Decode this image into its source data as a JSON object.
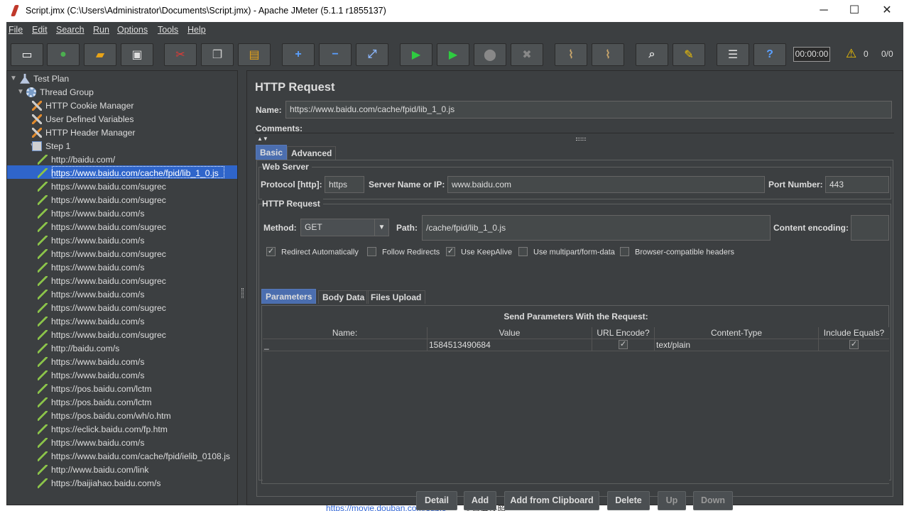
{
  "window": {
    "title": "Script.jmx (C:\\Users\\Administrator\\Documents\\Script.jmx) - Apache JMeter (5.1.1 r1855137)",
    "minimize": "─",
    "maximize": "☐",
    "close": "✕"
  },
  "menu": [
    "File",
    "Edit",
    "Search",
    "Run",
    "Options",
    "Tools",
    "Help"
  ],
  "toolbar": {
    "timer": "00:00:00",
    "warnings": "0",
    "threads": "0/0"
  },
  "tree": {
    "items": [
      {
        "label": "Test Plan",
        "icon": "flask-icon",
        "level": 0,
        "expand": "▼"
      },
      {
        "label": "Thread Group",
        "icon": "gear-icon",
        "level": 1,
        "expand": "▼"
      },
      {
        "label": "HTTP Cookie Manager",
        "icon": "wrench-icon",
        "level": 2,
        "expand": ""
      },
      {
        "label": "User Defined Variables",
        "icon": "wrench-icon",
        "level": 2,
        "expand": ""
      },
      {
        "label": "HTTP Header Manager",
        "icon": "wrench-icon",
        "level": 2,
        "expand": ""
      },
      {
        "label": "Step 1",
        "icon": "controller-icon",
        "level": 2,
        "expand": "▼"
      },
      {
        "label": "http://baidu.com/",
        "icon": "pipette-icon",
        "level": 3,
        "expand": ""
      },
      {
        "label": "https://www.baidu.com/cache/fpid/lib_1_0.js",
        "icon": "pipette-icon",
        "level": 3,
        "expand": "",
        "selected": true
      },
      {
        "label": "https://www.baidu.com/sugrec",
        "icon": "pipette-icon",
        "level": 3,
        "expand": ""
      },
      {
        "label": "https://www.baidu.com/sugrec",
        "icon": "pipette-icon",
        "level": 3,
        "expand": ""
      },
      {
        "label": "https://www.baidu.com/s",
        "icon": "pipette-icon",
        "level": 3,
        "expand": ""
      },
      {
        "label": "https://www.baidu.com/sugrec",
        "icon": "pipette-icon",
        "level": 3,
        "expand": ""
      },
      {
        "label": "https://www.baidu.com/s",
        "icon": "pipette-icon",
        "level": 3,
        "expand": ""
      },
      {
        "label": "https://www.baidu.com/sugrec",
        "icon": "pipette-icon",
        "level": 3,
        "expand": ""
      },
      {
        "label": "https://www.baidu.com/s",
        "icon": "pipette-icon",
        "level": 3,
        "expand": ""
      },
      {
        "label": "https://www.baidu.com/sugrec",
        "icon": "pipette-icon",
        "level": 3,
        "expand": ""
      },
      {
        "label": "https://www.baidu.com/s",
        "icon": "pipette-icon",
        "level": 3,
        "expand": ""
      },
      {
        "label": "https://www.baidu.com/sugrec",
        "icon": "pipette-icon",
        "level": 3,
        "expand": ""
      },
      {
        "label": "https://www.baidu.com/s",
        "icon": "pipette-icon",
        "level": 3,
        "expand": ""
      },
      {
        "label": "https://www.baidu.com/sugrec",
        "icon": "pipette-icon",
        "level": 3,
        "expand": ""
      },
      {
        "label": "http://baidu.com/s",
        "icon": "pipette-icon",
        "level": 3,
        "expand": ""
      },
      {
        "label": "https://www.baidu.com/s",
        "icon": "pipette-icon",
        "level": 3,
        "expand": ""
      },
      {
        "label": "https://www.baidu.com/s",
        "icon": "pipette-icon",
        "level": 3,
        "expand": ""
      },
      {
        "label": "https://pos.baidu.com/lctm",
        "icon": "pipette-icon",
        "level": 3,
        "expand": ""
      },
      {
        "label": "https://pos.baidu.com/lctm",
        "icon": "pipette-icon",
        "level": 3,
        "expand": ""
      },
      {
        "label": "https://pos.baidu.com/wh/o.htm",
        "icon": "pipette-icon",
        "level": 3,
        "expand": ""
      },
      {
        "label": "https://eclick.baidu.com/fp.htm",
        "icon": "pipette-icon",
        "level": 3,
        "expand": ""
      },
      {
        "label": "https://www.baidu.com/s",
        "icon": "pipette-icon",
        "level": 3,
        "expand": ""
      },
      {
        "label": "https://www.baidu.com/cache/fpid/ielib_0108.js",
        "icon": "pipette-icon",
        "level": 3,
        "expand": ""
      },
      {
        "label": "http://www.baidu.com/link",
        "icon": "pipette-icon",
        "level": 3,
        "expand": ""
      },
      {
        "label": "https://baijiahao.baidu.com/s",
        "icon": "pipette-icon",
        "level": 3,
        "expand": ""
      }
    ]
  },
  "panel": {
    "title": "HTTP Request",
    "name_label": "Name:",
    "name_value": "https://www.baidu.com/cache/fpid/lib_1_0.js",
    "comments_label": "Comments:",
    "tabs": [
      "Basic",
      "Advanced"
    ],
    "web_server": {
      "title": "Web Server",
      "protocol_label": "Protocol [http]:",
      "protocol": "https",
      "server_label": "Server Name or IP:",
      "server": "www.baidu.com",
      "port_label": "Port Number:",
      "port": "443"
    },
    "http_request": {
      "title": "HTTP Request",
      "method_label": "Method:",
      "method": "GET",
      "path_label": "Path:",
      "path": "/cache/fpid/lib_1_0.js",
      "encoding_label": "Content encoding:",
      "encoding": ""
    },
    "options": [
      {
        "label": "Redirect Automatically",
        "checked": true
      },
      {
        "label": "Follow Redirects",
        "checked": false
      },
      {
        "label": "Use KeepAlive",
        "checked": true
      },
      {
        "label": "Use multipart/form-data",
        "checked": false
      },
      {
        "label": "Browser-compatible headers",
        "checked": false
      }
    ],
    "sub_tabs": [
      "Parameters",
      "Body Data",
      "Files Upload"
    ],
    "params": {
      "title": "Send Parameters With the Request:",
      "columns": [
        "Name:",
        "Value",
        "URL Encode?",
        "Content-Type",
        "Include Equals?"
      ],
      "rows": [
        {
          "name": "_",
          "value": "1584513490684",
          "url_encode": true,
          "content_type": "text/plain",
          "include_equals": true
        }
      ]
    },
    "buttons": [
      "Detail",
      "Add",
      "Add from Clipboard",
      "Delete",
      "Up",
      "Down"
    ]
  },
  "background": {
    "link": "https://movie.douban.com/subje",
    "text": "- 百度快照"
  }
}
